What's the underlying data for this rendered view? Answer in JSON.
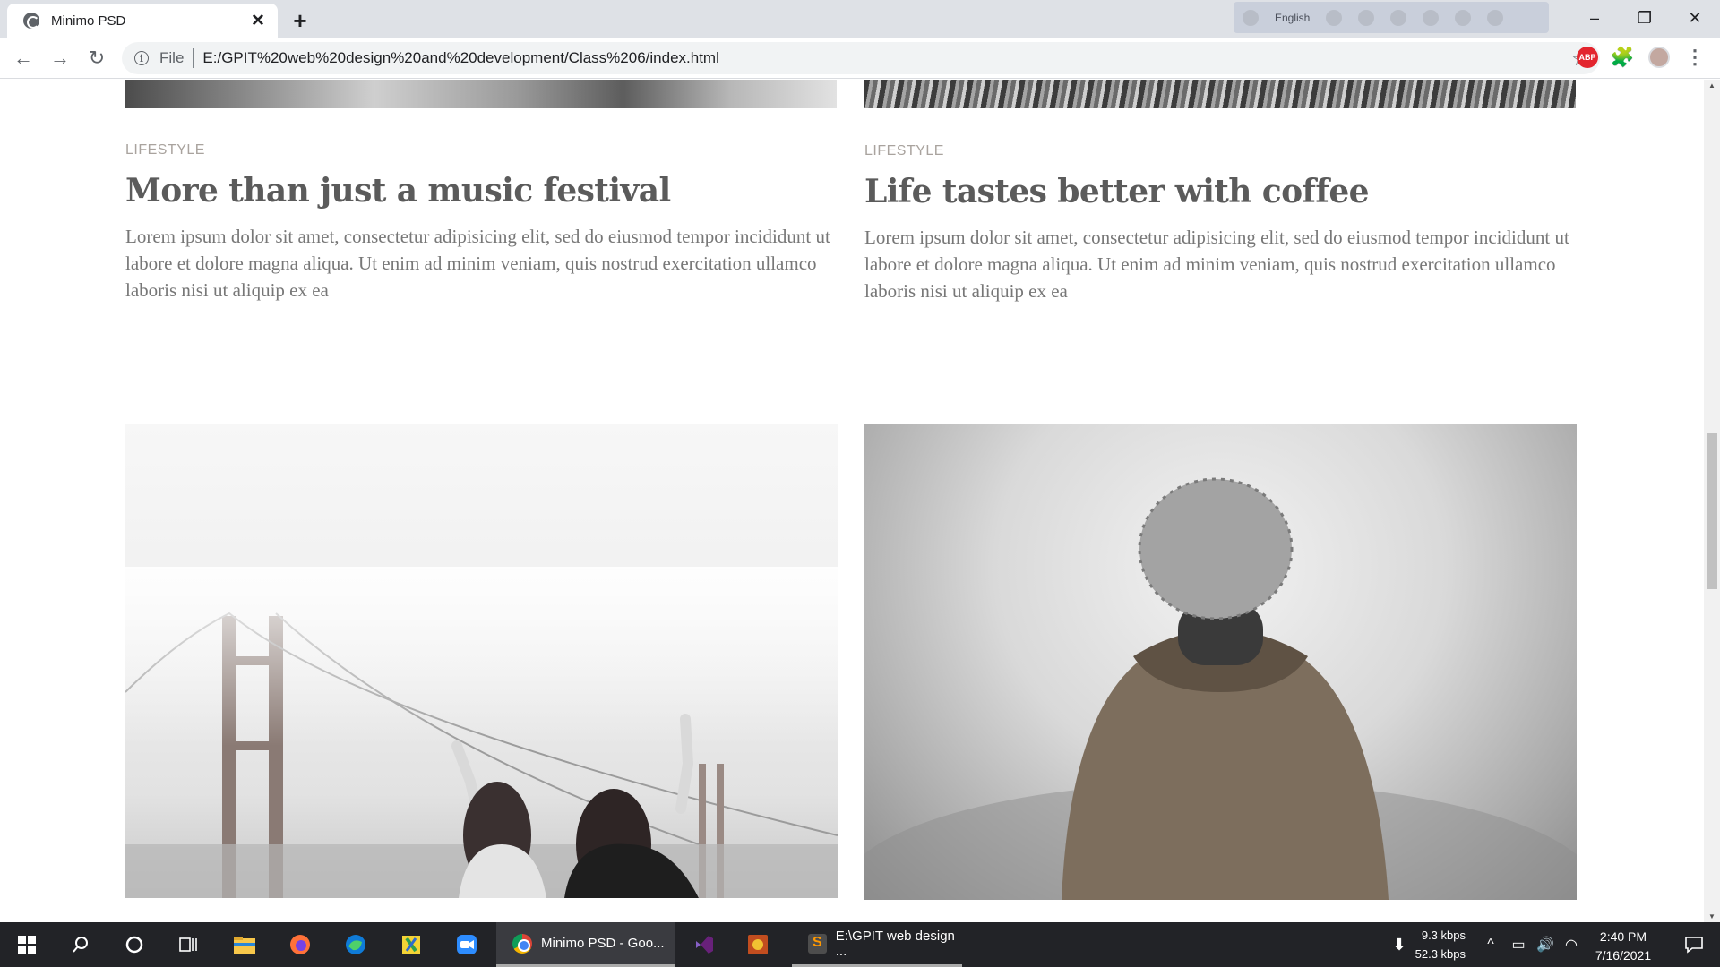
{
  "browser": {
    "tab_title": "Minimo PSD",
    "tab_close": "✕",
    "new_tab": "+",
    "ime_language": "English",
    "win_minimize": "–",
    "win_restore": "❐",
    "win_close": "✕",
    "back": "←",
    "forward": "→",
    "reload": "↻",
    "omni_scheme": "File",
    "url": "E:/GPIT%20web%20design%20and%20development/Class%206/index.html",
    "bookmark_star": "☆",
    "abp_label": "ABP",
    "extensions_icon": "🧩",
    "menu": "⋮"
  },
  "posts": [
    {
      "category": "LIFESTYLE",
      "title": "More than just a music festival",
      "excerpt": "Lorem ipsum dolor sit amet, consectetur adipisicing elit, sed do eiusmod tempor incididunt ut labore et dolore magna aliqua. Ut enim ad minim veniam, quis nostrud exercitation ullamco laboris nisi ut aliquip ex ea"
    },
    {
      "category": "LIFESTYLE",
      "title": "Life tastes better with coffee",
      "excerpt": "Lorem ipsum dolor sit amet, consectetur adipisicing elit, sed do eiusmod tempor incididunt ut labore et dolore magna aliqua. Ut enim ad minim veniam, quis nostrud exercitation ullamco laboris nisi ut aliquip ex ea"
    }
  ],
  "taskbar": {
    "start_icon": "windows-logo-icon",
    "apps": [
      {
        "label": "Minimo PSD - Goo..."
      },
      {
        "label": "E:\\GPIT web design ..."
      }
    ],
    "net_down": "9.3 kbps",
    "net_up": "52.3 kbps",
    "time": "2:40 PM",
    "date": "7/16/2021"
  },
  "colors": {
    "tab_strip": "#dee1e6",
    "omnibox": "#f1f3f4",
    "category_text": "#a9a39e",
    "headline_text": "#5b5b5b",
    "body_text": "#777777",
    "taskbar": "#222327"
  }
}
